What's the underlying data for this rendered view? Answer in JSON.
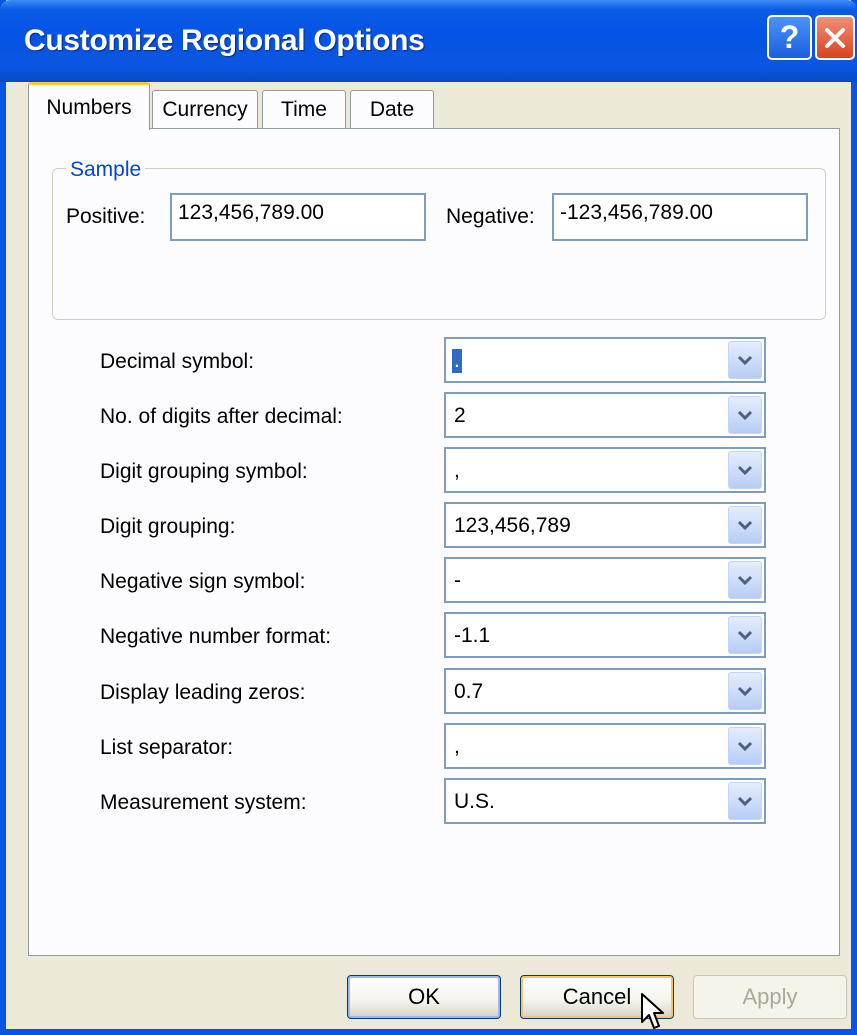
{
  "window": {
    "title": "Customize Regional Options"
  },
  "titlebar": {
    "help_label": "?",
    "close_icon": "close-icon"
  },
  "tabs": [
    {
      "label": "Numbers",
      "active": true
    },
    {
      "label": "Currency",
      "active": false
    },
    {
      "label": "Time",
      "active": false
    },
    {
      "label": "Date",
      "active": false
    }
  ],
  "sample": {
    "legend": "Sample",
    "positive_label": "Positive:",
    "positive_value": "123,456,789.00",
    "negative_label": "Negative:",
    "negative_value": "-123,456,789.00"
  },
  "settings": [
    {
      "label": "Decimal symbol:",
      "value": "."
    },
    {
      "label": "No. of digits after decimal:",
      "value": "2"
    },
    {
      "label": "Digit grouping symbol:",
      "value": ","
    },
    {
      "label": "Digit grouping:",
      "value": "123,456,789"
    },
    {
      "label": "Negative sign symbol:",
      "value": "-"
    },
    {
      "label": "Negative number format:",
      "value": "-1.1"
    },
    {
      "label": "Display leading zeros:",
      "value": "0.7"
    },
    {
      "label": "List separator:",
      "value": ","
    },
    {
      "label": "Measurement system:",
      "value": "U.S."
    }
  ],
  "buttons": {
    "ok": "OK",
    "cancel": "Cancel",
    "apply": "Apply"
  },
  "colors": {
    "titlebar": "#0553e4",
    "accent_tab": "#ffc83c",
    "legend_text": "#0046d5",
    "selection": "#316ac5"
  }
}
